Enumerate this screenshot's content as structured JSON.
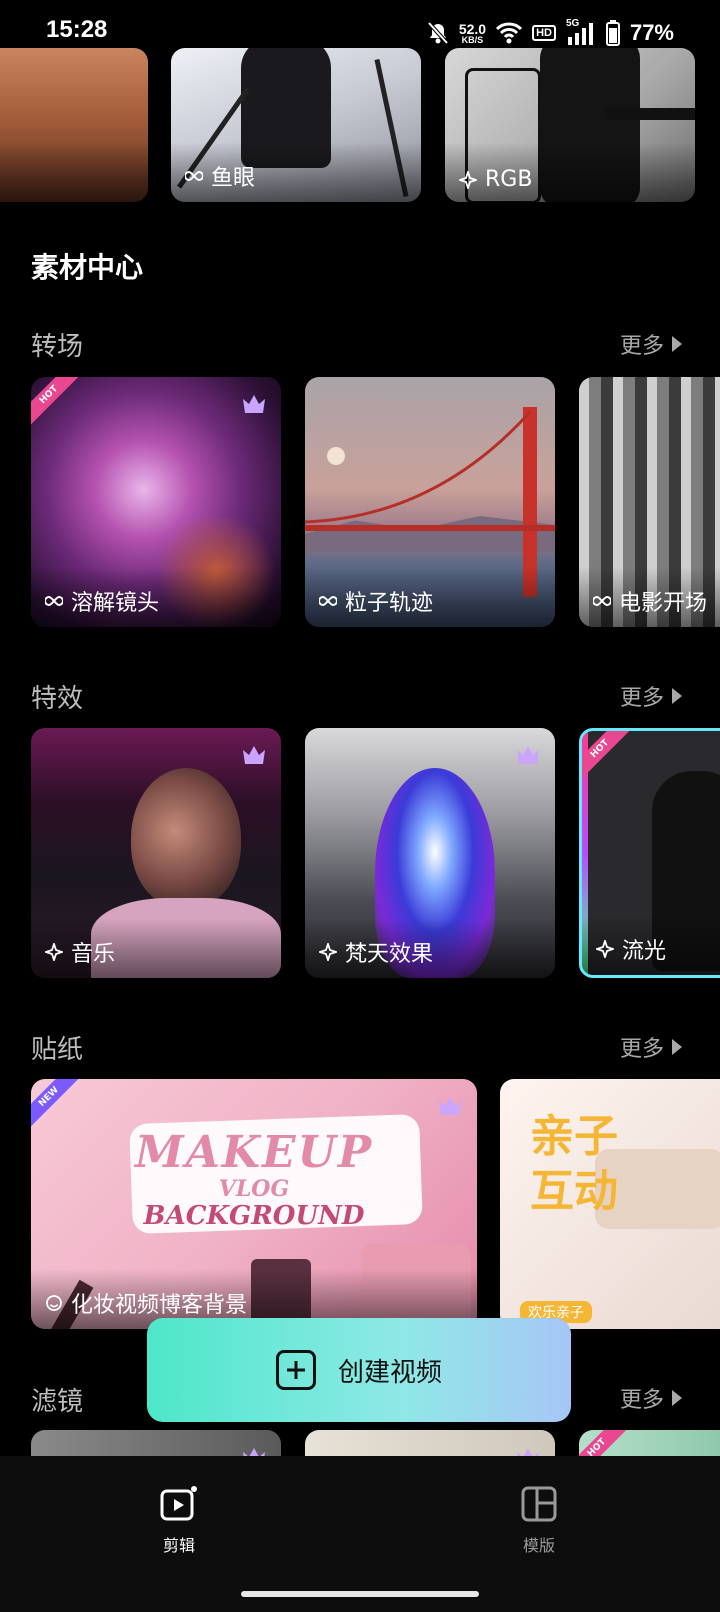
{
  "status_bar": {
    "time": "15:28",
    "net_speed_value": "52.0",
    "net_speed_unit": "KB/S",
    "hd": "HD",
    "signal_type": "5G",
    "battery": "77%"
  },
  "top_row": {
    "tiles": [
      {
        "label": ""
      },
      {
        "label": "鱼眼",
        "icon": "infinity-icon"
      },
      {
        "label": "RGB",
        "icon": "sparkle-icon"
      }
    ]
  },
  "main_title": "素材中心",
  "sections": [
    {
      "title": "转场",
      "more": "更多",
      "items": [
        {
          "label": "溶解镜头",
          "icon": "infinity-icon",
          "badge": "HOT",
          "premium": true
        },
        {
          "label": "粒子轨迹",
          "icon": "infinity-icon"
        },
        {
          "label": "电影开场",
          "icon": "infinity-icon"
        }
      ]
    },
    {
      "title": "特效",
      "more": "更多",
      "items": [
        {
          "label": "音乐",
          "icon": "sparkle-icon",
          "premium": true
        },
        {
          "label": "梵天效果",
          "icon": "sparkle-icon",
          "premium": true
        },
        {
          "label": "流光",
          "icon": "sparkle-icon",
          "badge": "HOT"
        }
      ]
    },
    {
      "title": "贴纸",
      "more": "更多",
      "items": [
        {
          "label": "化妆视频博客背景",
          "icon": "smile-icon",
          "badge": "NEW",
          "premium": true,
          "art_lines": [
            "MAKEUP",
            "VLOG",
            "BACKGROUND"
          ]
        },
        {
          "label": "",
          "art_lines": [
            "亲子",
            "互动"
          ],
          "art_tag": "欢乐亲子"
        }
      ]
    },
    {
      "title": "滤镜",
      "more": "更多"
    }
  ],
  "create_button": {
    "label": "创建视频"
  },
  "bottom_nav": {
    "items": [
      {
        "label": "剪辑",
        "icon": "edit-video-icon",
        "active": true
      },
      {
        "label": "模版",
        "icon": "template-icon",
        "active": false
      }
    ]
  }
}
